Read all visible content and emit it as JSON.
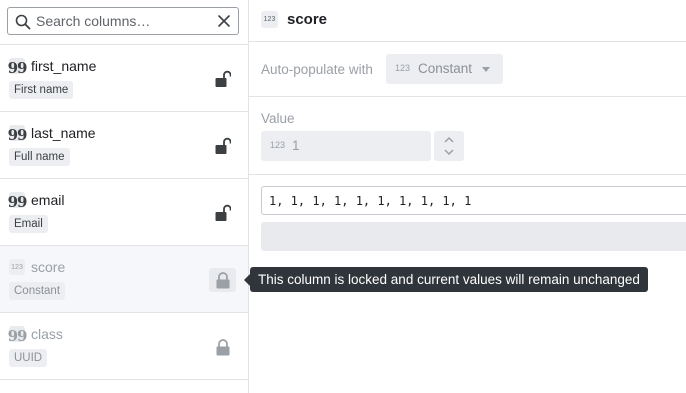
{
  "search": {
    "placeholder": "Search columns…",
    "icon": "magnifier-icon",
    "clear_icon": "close-icon"
  },
  "columns": [
    {
      "name": "first_name",
      "type_icon": "quote-icon",
      "tag": "First name",
      "locked": false
    },
    {
      "name": "last_name",
      "type_icon": "quote-icon",
      "tag": "Full name",
      "locked": false
    },
    {
      "name": "email",
      "type_icon": "quote-icon",
      "tag": "Email",
      "locked": false
    },
    {
      "name": "score",
      "type_icon": "number-icon",
      "type_badge": "123",
      "tag": "Constant",
      "locked": true,
      "selected": true
    },
    {
      "name": "class",
      "type_icon": "quote-icon",
      "tag": "UUID",
      "locked": true
    }
  ],
  "detail": {
    "type_badge": "123",
    "title": "score",
    "autopopulate_label": "Auto-populate with",
    "autopopulate_badge": "123",
    "autopopulate_value": "Constant",
    "value_label": "Value",
    "value_badge": "123",
    "value": "1",
    "preview": "1, 1, 1, 1, 1, 1, 1, 1, 1, 1"
  },
  "tooltip": "This column is locked and current values will remain unchanged",
  "colors": {
    "accent_dark": "#30353b",
    "muted": "#9aa0a6",
    "chip_bg": "#eceef1"
  }
}
